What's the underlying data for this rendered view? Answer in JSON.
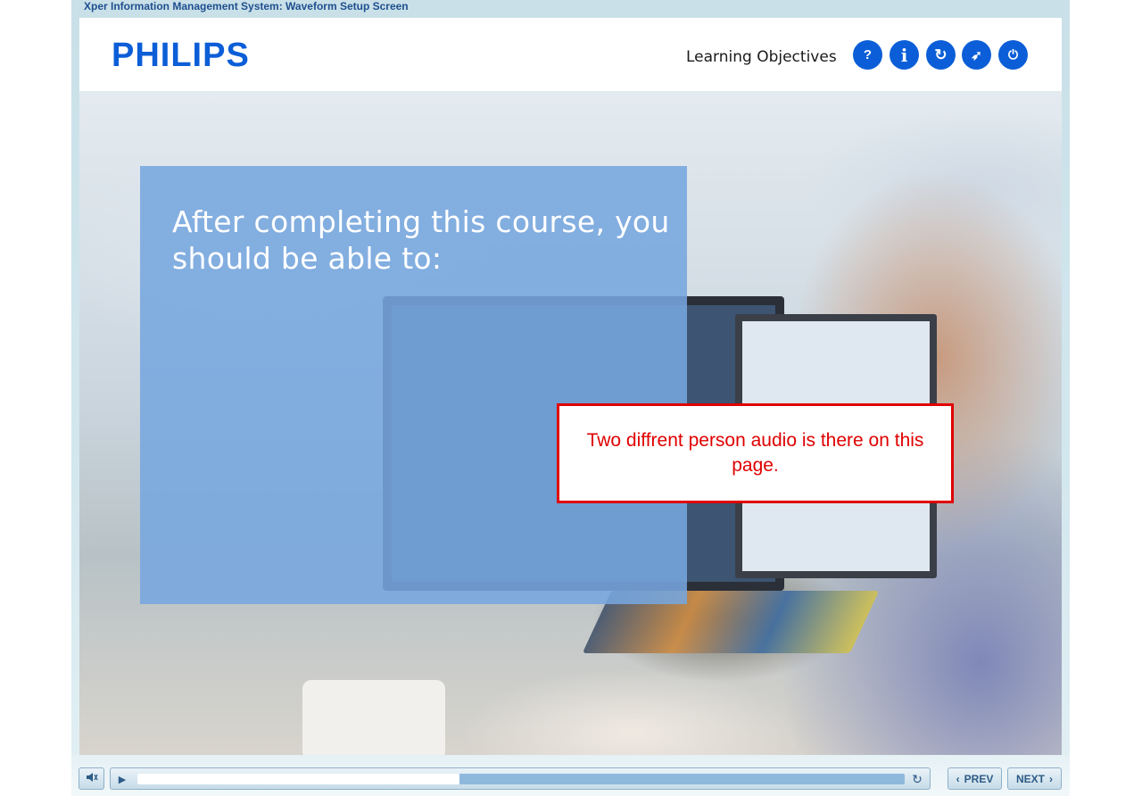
{
  "window": {
    "title": "Xper Information Management System: Waveform Setup Screen"
  },
  "header": {
    "logo": "PHILIPS",
    "section_label": "Learning Objectives",
    "buttons": [
      {
        "name": "help",
        "glyph": "?"
      },
      {
        "name": "info",
        "glyph": "i"
      },
      {
        "name": "refresh",
        "glyph": "↻"
      },
      {
        "name": "compass",
        "glyph": "➶"
      },
      {
        "name": "power",
        "glyph": "⏻"
      }
    ]
  },
  "content": {
    "heading": "After completing this course, you should be able to:"
  },
  "note": {
    "text": "Two diffrent person audio is there on this page."
  },
  "player": {
    "progress": 0.42,
    "prev_label": "PREV",
    "next_label": "NEXT"
  },
  "colors": {
    "brand": "#0b5ed7",
    "note_border": "#e00000",
    "content_box": "#76a6de"
  }
}
